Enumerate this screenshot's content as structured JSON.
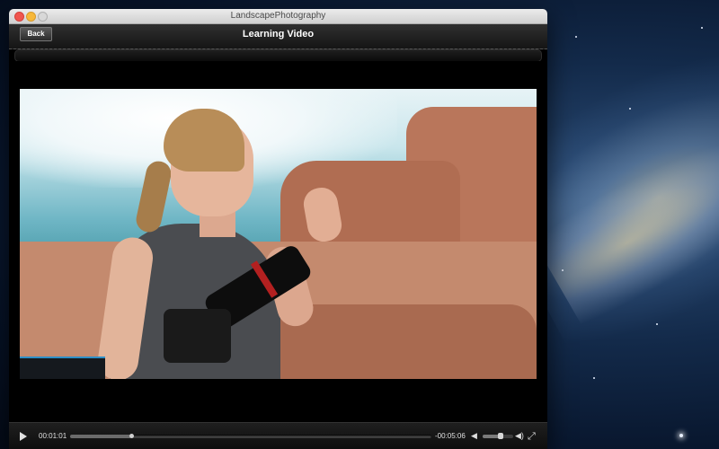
{
  "window": {
    "title": "LandscapePhotography"
  },
  "toolbar": {
    "back_label": "Back",
    "title": "Learning Video"
  },
  "player": {
    "elapsed": "00:01:01",
    "remaining": "-00:05:06",
    "progress_fraction": 0.17,
    "volume_fraction": 0.6
  },
  "icons": {
    "play": "play-icon",
    "volume_low": "volume-low-icon",
    "volume_high": "volume-high-icon",
    "fullscreen": "fullscreen-icon"
  },
  "glyphs": {
    "volume_low": "◀",
    "volume_high": "◀)",
    "fullscreen": "⤢"
  },
  "colors": {
    "window_bg": "#000000",
    "desktop": "#0b1d38"
  }
}
